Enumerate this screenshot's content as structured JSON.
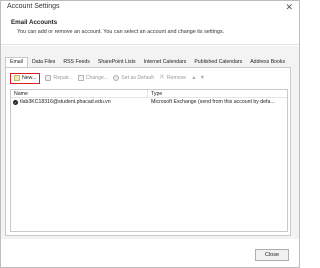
{
  "window": {
    "title": "Account Settings",
    "close_glyph": "✕"
  },
  "header": {
    "section_title": "Email Accounts",
    "description": "You can add or remove an account. You can select an account and change its settings."
  },
  "tabs": [
    {
      "label": "Email",
      "active": true
    },
    {
      "label": "Data Files",
      "active": false
    },
    {
      "label": "RSS Feeds",
      "active": false
    },
    {
      "label": "SharePoint Lists",
      "active": false
    },
    {
      "label": "Internet Calendars",
      "active": false
    },
    {
      "label": "Published Calendars",
      "active": false
    },
    {
      "label": "Address Books",
      "active": false
    }
  ],
  "toolbar": {
    "new_label": "New...",
    "repair_label": "Repair...",
    "change_label": "Change...",
    "default_label": "Set as Default",
    "remove_label": "Remove",
    "up_glyph": "▲",
    "down_glyph": "▼"
  },
  "accounts_table": {
    "columns": [
      "Name",
      "Type"
    ],
    "rows": [
      {
        "name": "tlab3KC18316@student.phacad.edu.vn",
        "type": "Microsoft Exchange (send from this account by defa..."
      }
    ]
  },
  "footer": {
    "close_label": "Close"
  },
  "colors": {
    "highlight_border": "#d42020",
    "panel_bg": "#f3f3f3"
  }
}
